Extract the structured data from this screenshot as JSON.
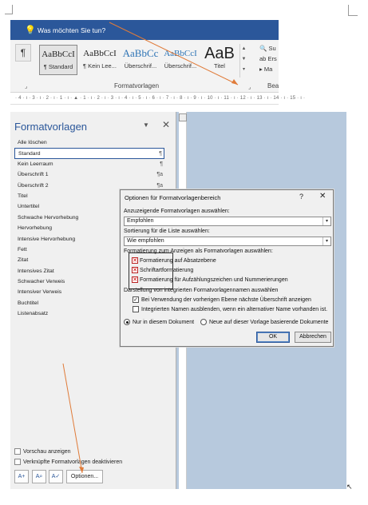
{
  "ribbon": {
    "tell_me": "Was möchten Sie tun?",
    "paragraph_mark": "¶",
    "styles": [
      {
        "sample": "AaBbCcI",
        "name": "¶ Standard"
      },
      {
        "sample": "AaBbCcI",
        "name": "¶ Kein Lee..."
      },
      {
        "sample": "AaBbCc",
        "name": "Überschrif..."
      },
      {
        "sample": "AaBbCcI",
        "name": "Überschrif..."
      },
      {
        "sample": "AaB",
        "name": "Titel"
      }
    ],
    "group_label": "Formatvorlagen",
    "side_items": [
      "Su",
      "Ers",
      "Ma"
    ],
    "side_group": "Bea"
  },
  "ruler_text": "· 4 · ı · 3 · ı · 2 · ı · 1 · ı · ▲ · 1 · ı · 2 · ı · 3 · ı · 4 · ı · 5 · ı · 6 · ı · 7 · ı · 8 · ı · 9 · ı · 10 · ı · 11 · ı · 12 · ı · 13 · ı · 14 · ı · 15 · ı ·",
  "pane": {
    "title": "Formatvorlagen",
    "menu": "▼",
    "close": "✕",
    "styles": [
      {
        "label": "Alle löschen",
        "mark": ""
      },
      {
        "label": "Standard",
        "mark": "¶"
      },
      {
        "label": "Kein Leerraum",
        "mark": "¶"
      },
      {
        "label": "Überschrift 1",
        "mark": "¶a"
      },
      {
        "label": "Überschrift 2",
        "mark": "¶a"
      },
      {
        "label": "Titel",
        "mark": ""
      },
      {
        "label": "Untertitel",
        "mark": ""
      },
      {
        "label": "Schwache Hervorhebung",
        "mark": ""
      },
      {
        "label": "Hervorhebung",
        "mark": ""
      },
      {
        "label": "Intensive Hervorhebung",
        "mark": ""
      },
      {
        "label": "Fett",
        "mark": ""
      },
      {
        "label": "Zitat",
        "mark": ""
      },
      {
        "label": "Intensives Zitat",
        "mark": ""
      },
      {
        "label": "Schwacher Verweis",
        "mark": ""
      },
      {
        "label": "Intensiver Verweis",
        "mark": ""
      },
      {
        "label": "Buchtitel",
        "mark": ""
      },
      {
        "label": "Listenabsatz",
        "mark": ""
      }
    ],
    "preview_label": "Vorschau anzeigen",
    "linked_label": "Verknüpfte Formatvorlagen deaktivieren",
    "options_label": "Optionen..."
  },
  "dialog": {
    "title": "Optionen für Formatvorlagenbereich",
    "help": "?",
    "close": "✕",
    "show_label": "Anzuzeigende Formatvorlagen auswählen:",
    "show_value": "Empfohlen",
    "sort_label": "Sortierung für die Liste auswählen:",
    "sort_value": "Wie empfohlen",
    "format_label": "Formatierung zum Anzeigen als Formatvorlagen auswählen:",
    "format_items": [
      "Formatierung auf Absatzebene",
      "Schriftartformatierung",
      "Formatierung für Aufzählungszeichen und Nummerierungen"
    ],
    "builtin_label": "Darstellung von integrierten Formatvorlagennamen auswählen",
    "check_next_heading": "Bei Verwendung der vorherigen Ebene nächste Überschrift anzeigen",
    "check_hide_builtin": "Integrierten Namen ausblenden, wenn ein alternativer Name vorhanden ist.",
    "radio_doc": "Nur in diesem Dokument",
    "radio_template": "Neue auf dieser Vorlage basierende Dokumente",
    "ok": "OK",
    "cancel": "Abbrechen"
  },
  "colors": {
    "brand": "#2b579a",
    "arrow": "#e07b39",
    "workspace": "#b7c9dd"
  }
}
